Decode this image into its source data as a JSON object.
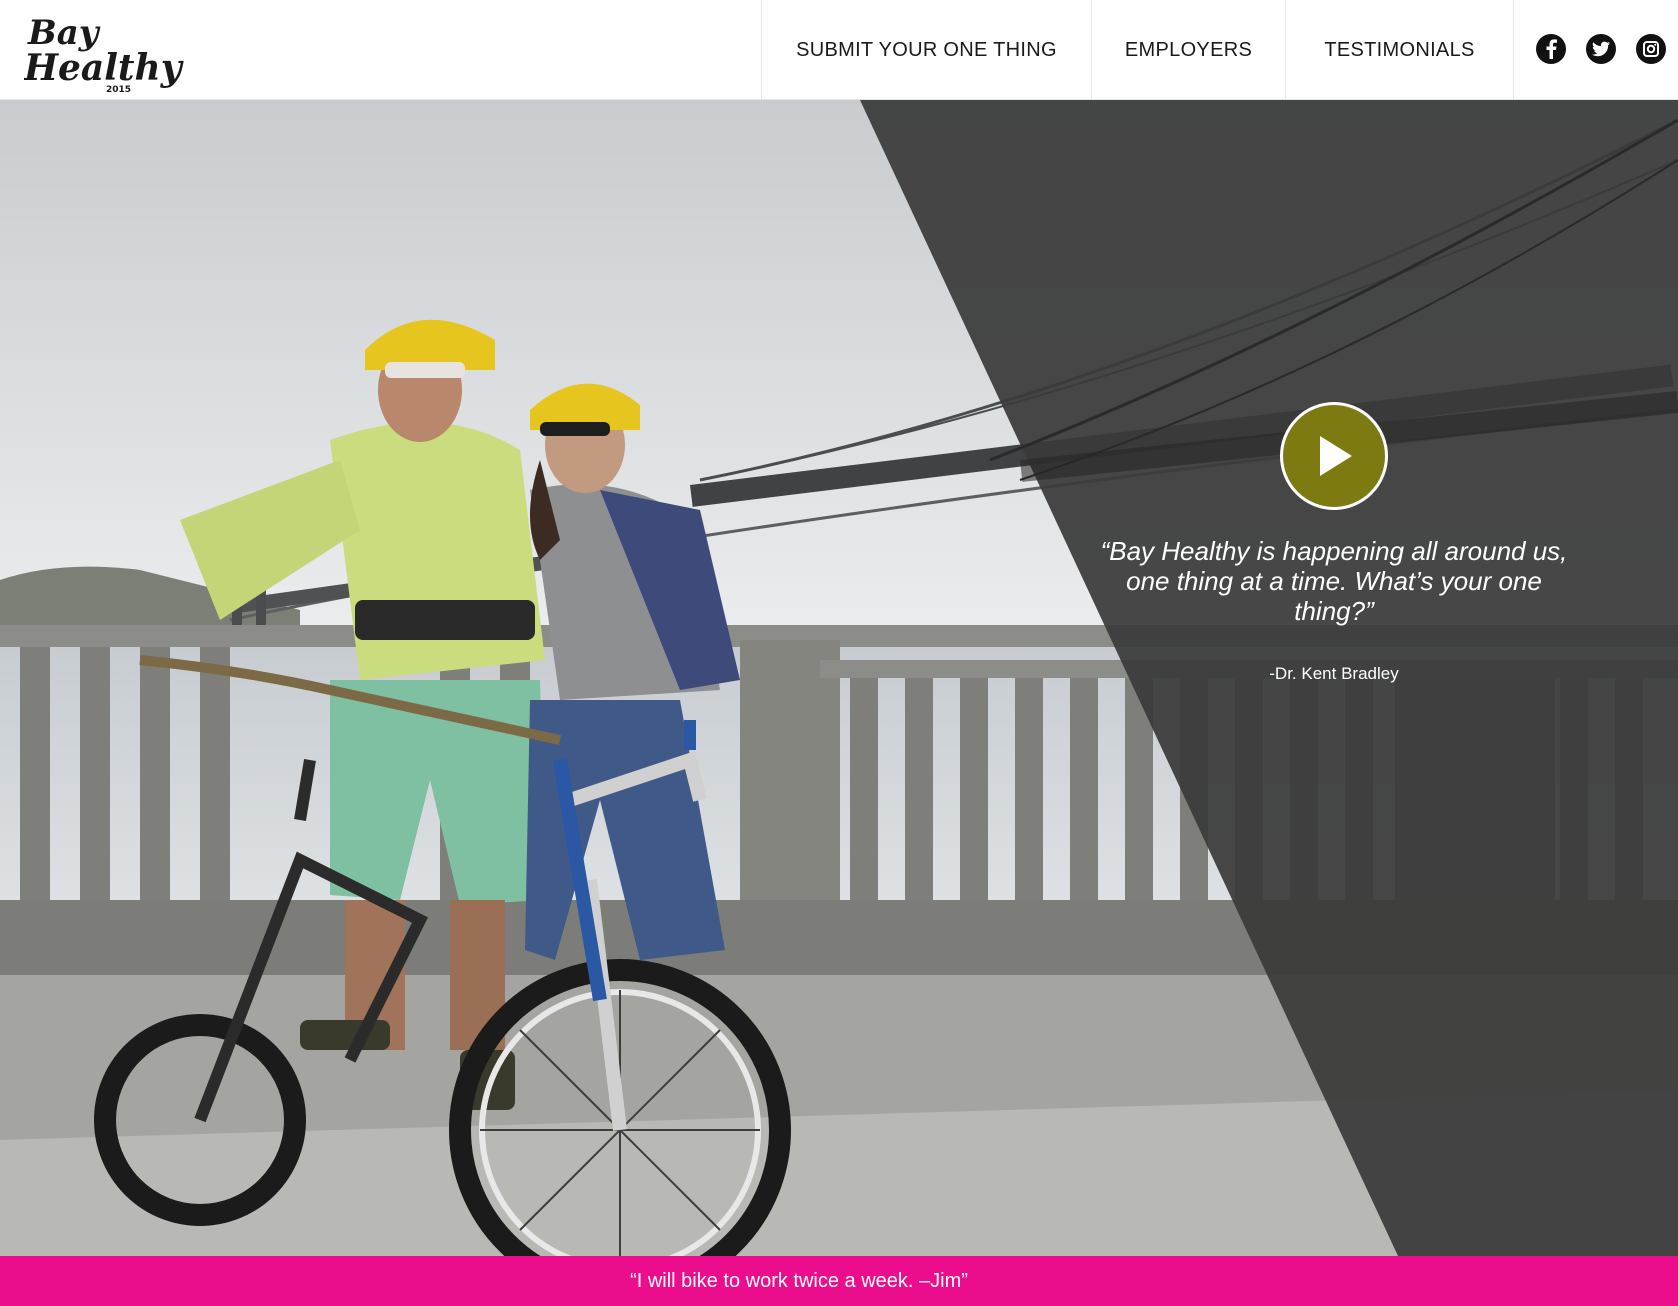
{
  "logo": {
    "line1": "Bay",
    "line2": "Healthy",
    "year": "2015"
  },
  "nav": {
    "items": [
      {
        "label": "SUBMIT YOUR ONE THING"
      },
      {
        "label": "EMPLOYERS"
      },
      {
        "label": "TESTIMONIALS"
      }
    ]
  },
  "social": {
    "icons": [
      "facebook-icon",
      "twitter-icon",
      "instagram-icon"
    ]
  },
  "hero": {
    "quote": "“Bay Healthy is happening all around us, one thing at a time. What’s your one thing?”",
    "author": "-Dr. Kent Bradley",
    "play_icon": "play-icon"
  },
  "ticker": {
    "text": "“I will bike to work twice a week. –Jim”"
  },
  "colors": {
    "accent_pink": "#ec0d8c",
    "play_olive": "#7d7a12",
    "overlay_dark": "#3a3a3a"
  }
}
